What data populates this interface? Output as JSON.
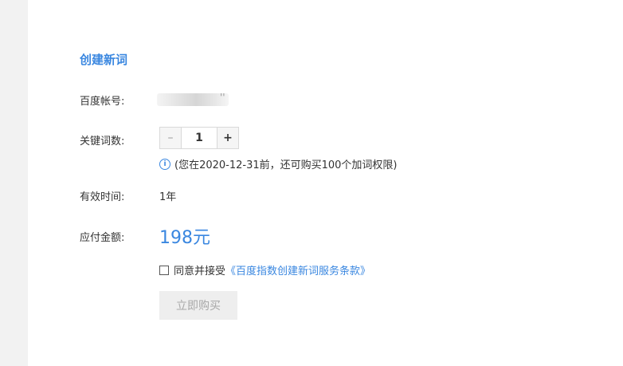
{
  "form": {
    "title": "创建新词",
    "account_label": "百度帐号:",
    "account_value_visible_tail": "''",
    "keywords_label": "关键词数:",
    "stepper": {
      "minus": "–",
      "value": "1",
      "plus": "+"
    },
    "hint_icon": "i",
    "hint": "(您在2020-12-31前，还可购买100个加词权限)",
    "validity_label": "有效时间:",
    "validity_value": "1年",
    "amount_label": "应付金额:",
    "amount_value": "198元",
    "agree_text": "同意并接受",
    "agree_link": "《百度指数创建新词服务条款》",
    "buy_button": "立即购买"
  },
  "colors": {
    "accent": "#3a87e0",
    "sidebar": "#f2f2f2",
    "disabled_button_bg": "#eeeeee"
  }
}
